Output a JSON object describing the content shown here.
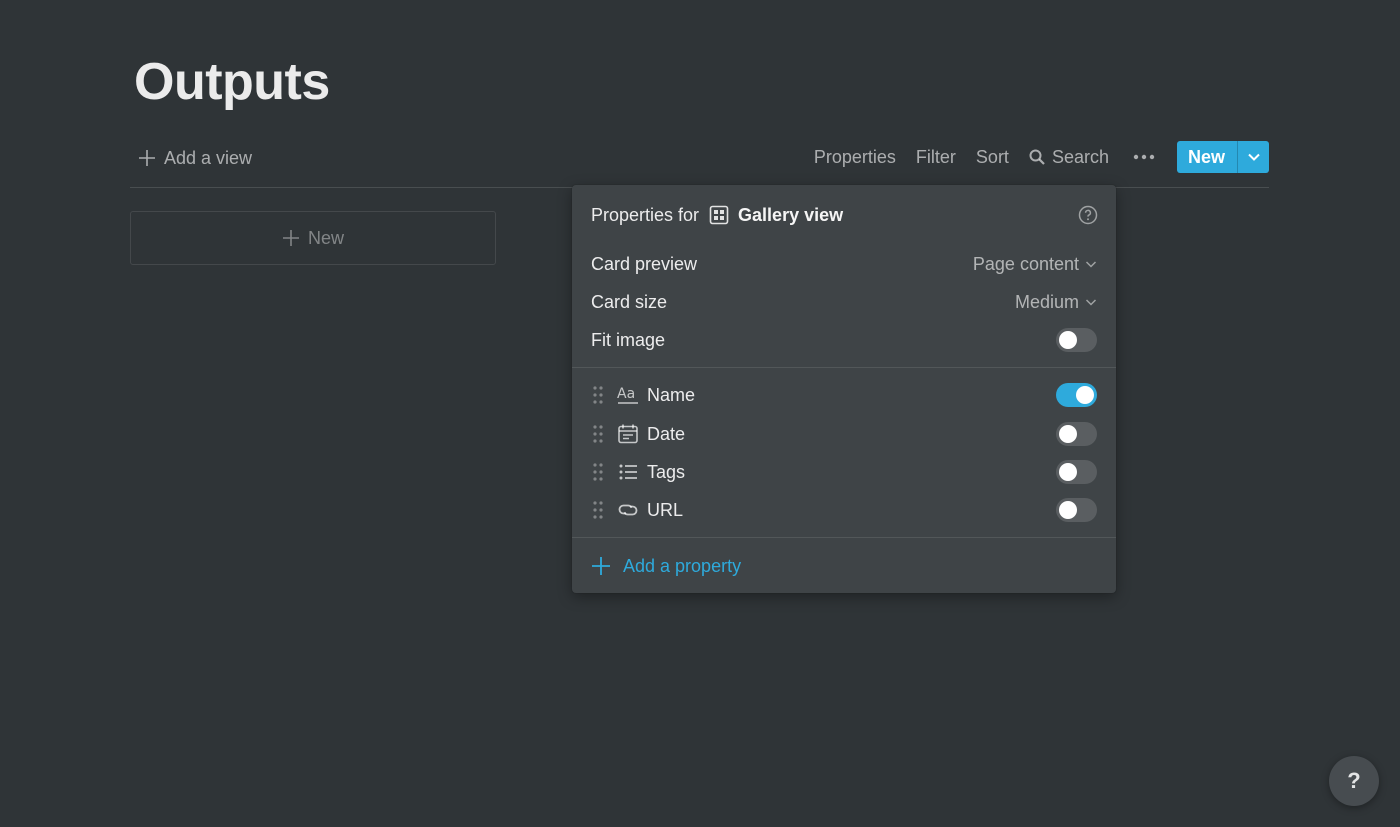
{
  "page": {
    "title": "Outputs"
  },
  "toolbar": {
    "add_view_label": "Add a view",
    "properties_label": "Properties",
    "filter_label": "Filter",
    "sort_label": "Sort",
    "search_label": "Search",
    "new_label": "New"
  },
  "gallery": {
    "new_card_label": "New"
  },
  "popup": {
    "header_prefix": "Properties for",
    "view_name": "Gallery view",
    "card_preview": {
      "label": "Card preview",
      "value": "Page content"
    },
    "card_size": {
      "label": "Card size",
      "value": "Medium"
    },
    "fit_image": {
      "label": "Fit image",
      "enabled": false
    },
    "properties": [
      {
        "name": "Name",
        "icon": "text-aa-icon",
        "visible": true
      },
      {
        "name": "Date",
        "icon": "calendar-icon",
        "visible": false
      },
      {
        "name": "Tags",
        "icon": "list-icon",
        "visible": false
      },
      {
        "name": "URL",
        "icon": "link-icon",
        "visible": false
      }
    ],
    "add_property_label": "Add a property"
  },
  "help": {
    "label": "?"
  },
  "colors": {
    "background": "#2f3437",
    "accent": "#2eaadc",
    "popup": "#3f4447"
  }
}
